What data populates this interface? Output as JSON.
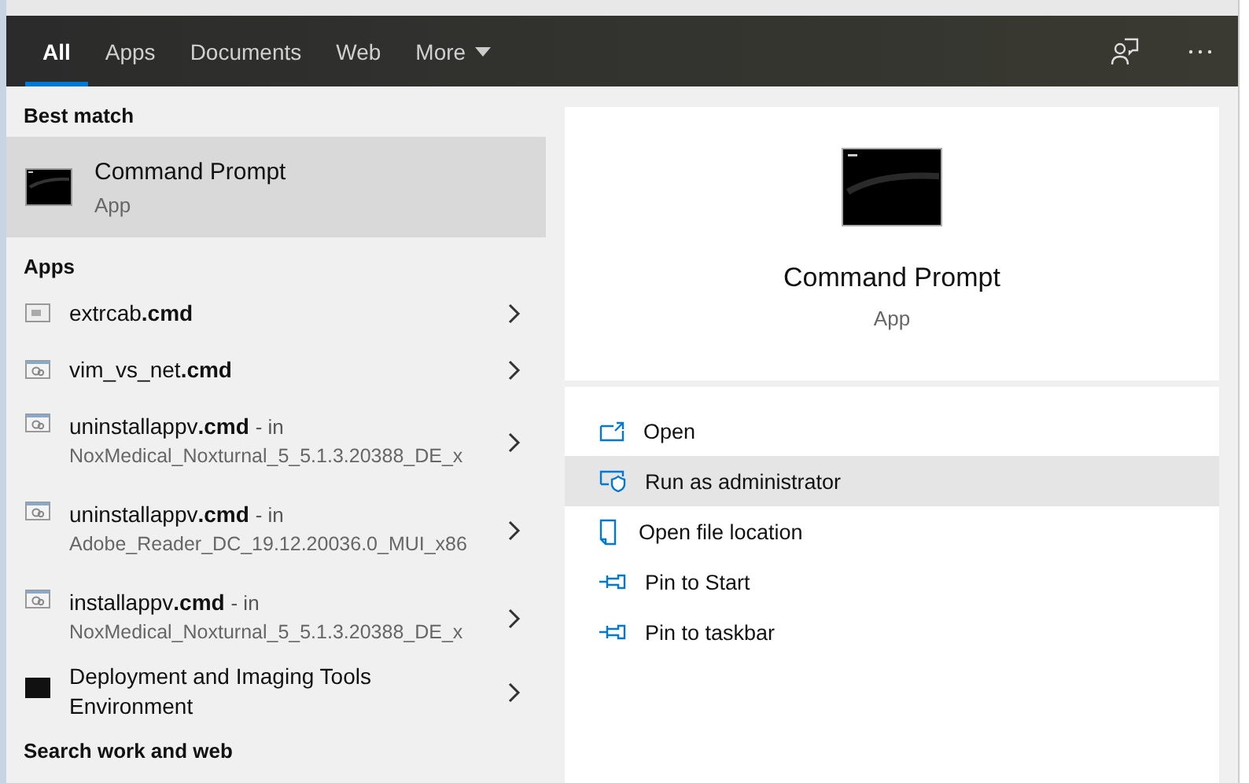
{
  "tabs": [
    {
      "label": "All",
      "selected": true
    },
    {
      "label": "Apps",
      "selected": false
    },
    {
      "label": "Documents",
      "selected": false
    },
    {
      "label": "Web",
      "selected": false
    },
    {
      "label": "More",
      "selected": false,
      "dropdown": true
    }
  ],
  "best_match": {
    "heading": "Best match",
    "name": "Command Prompt",
    "type": "App",
    "selected": true
  },
  "apps": {
    "heading": "Apps",
    "items": [
      {
        "kind": "script-plain",
        "name": "extrcab**.cmd**"
      },
      {
        "kind": "script",
        "name": "vim_vs_net**.cmd**"
      },
      {
        "kind": "script",
        "name": "uninstallappv**.cmd**",
        "suffix": "- in",
        "location": "NoxMedical_Noxturnal_5_5.1.3.20388_DE_x"
      },
      {
        "kind": "script",
        "name": "uninstallappv**.cmd**",
        "suffix": "- in",
        "location": "Adobe_Reader_DC_19.12.20036.0_MUI_x86"
      },
      {
        "kind": "script",
        "name": "installappv**.cmd**",
        "suffix": "- in",
        "location": "NoxMedical_Noxturnal_5_5.1.3.20388_DE_x"
      },
      {
        "kind": "console",
        "name": "Deployment and Imaging Tools Environment"
      }
    ]
  },
  "search_section": {
    "heading": "Search work and web"
  },
  "preview": {
    "title": "Command Prompt",
    "type": "App",
    "actions": [
      {
        "kind": "open",
        "label": "Open",
        "selected": false
      },
      {
        "kind": "admin",
        "label": "Run as administrator",
        "selected": true
      },
      {
        "kind": "folder",
        "label": "Open file location",
        "selected": false
      },
      {
        "kind": "pin",
        "label": "Pin to Start",
        "selected": false
      },
      {
        "kind": "pin",
        "label": "Pin to taskbar",
        "selected": false
      }
    ]
  }
}
